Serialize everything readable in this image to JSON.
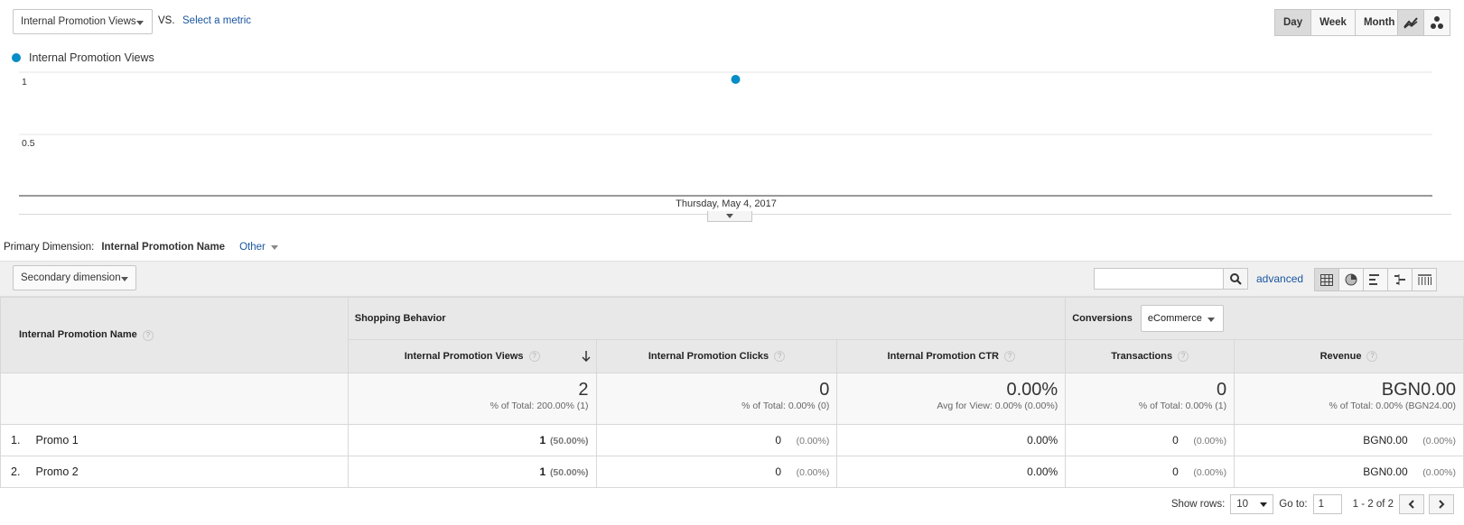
{
  "metric_selector": {
    "value": "Internal Promotion Views"
  },
  "vs_label": "VS.",
  "select_metric_link": "Select a metric",
  "period_buttons": [
    {
      "label": "Day",
      "active": true
    },
    {
      "label": "Week",
      "active": false
    },
    {
      "label": "Month",
      "active": false
    }
  ],
  "chart_type_buttons": [
    {
      "icon": "line-chart-icon",
      "active": true
    },
    {
      "icon": "motion-chart-icon",
      "active": false
    }
  ],
  "chart_data": {
    "type": "line",
    "series": [
      {
        "name": "Internal Promotion Views",
        "color": "#058dc7",
        "values": [
          1
        ]
      }
    ],
    "x": [
      "Thursday, May 4, 2017"
    ],
    "ytick_labels": [
      "1",
      "0.5"
    ],
    "ylim": [
      0,
      1
    ],
    "grid": true,
    "legend": "top-left"
  },
  "primary_dimension": {
    "label": "Primary Dimension:",
    "active": "Internal Promotion Name",
    "other": "Other"
  },
  "secondary_dimension": {
    "label": "Secondary dimension"
  },
  "search": {
    "placeholder": ""
  },
  "advanced_link": "advanced",
  "view_buttons": [
    "table-icon",
    "pie-icon",
    "bar-icon",
    "comparison-icon",
    "pivot-icon"
  ],
  "table": {
    "dimension_header": "Internal Promotion Name",
    "group_shopping": "Shopping Behavior",
    "group_conversions": "Conversions",
    "conversions_select": "eCommerce",
    "columns": [
      "Internal Promotion Views",
      "Internal Promotion Clicks",
      "Internal Promotion CTR",
      "Transactions",
      "Revenue"
    ],
    "totals": [
      {
        "value": "2",
        "sub": "% of Total: 200.00% (1)"
      },
      {
        "value": "0",
        "sub": "% of Total: 0.00% (0)"
      },
      {
        "value": "0.00%",
        "sub": "Avg for View: 0.00% (0.00%)"
      },
      {
        "value": "0",
        "sub": "% of Total: 0.00% (1)"
      },
      {
        "value": "BGN0.00",
        "sub": "% of Total: 0.00% (BGN24.00)"
      }
    ],
    "rows": [
      {
        "index": "1.",
        "name": "Promo 1",
        "views": "1",
        "views_pct": "(50.00%)",
        "clicks": "0",
        "clicks_pct": "(0.00%)",
        "ctr": "0.00%",
        "transactions": "0",
        "transactions_pct": "(0.00%)",
        "revenue": "BGN0.00",
        "revenue_pct": "(0.00%)"
      },
      {
        "index": "2.",
        "name": "Promo 2",
        "views": "1",
        "views_pct": "(50.00%)",
        "clicks": "0",
        "clicks_pct": "(0.00%)",
        "ctr": "0.00%",
        "transactions": "0",
        "transactions_pct": "(0.00%)",
        "revenue": "BGN0.00",
        "revenue_pct": "(0.00%)"
      }
    ]
  },
  "footer": {
    "show_rows_label": "Show rows:",
    "show_rows_value": "10",
    "goto_label": "Go to:",
    "goto_value": "1",
    "range": "1 - 2 of 2"
  }
}
